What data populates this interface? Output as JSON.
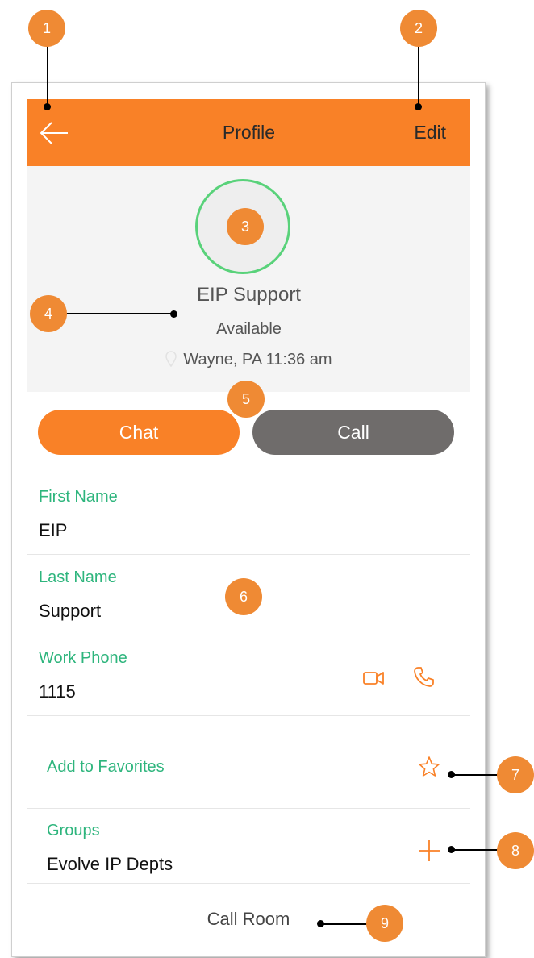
{
  "appbar": {
    "title": "Profile",
    "edit_label": "Edit"
  },
  "contact": {
    "name": "EIP Support",
    "presence": "Available",
    "location": "Wayne, PA 11:36 am"
  },
  "actions": {
    "chat_label": "Chat",
    "call_label": "Call"
  },
  "fields": [
    {
      "label": "First Name",
      "value": "EIP"
    },
    {
      "label": "Last Name",
      "value": "Support"
    },
    {
      "label": "Work Phone",
      "value": "1115"
    }
  ],
  "favorites": {
    "label": "Add to Favorites"
  },
  "groups": {
    "label": "Groups",
    "value": "Evolve IP Depts"
  },
  "call_room": {
    "label": "Call Room"
  },
  "callouts": [
    "1",
    "2",
    "3",
    "4",
    "5",
    "6",
    "7",
    "8",
    "9"
  ],
  "colors": {
    "accent": "#f98127",
    "green": "#2eb57d",
    "call_button": "#6f6c6b",
    "presence_ring": "#59d27a",
    "callout": "#ef8a34"
  }
}
